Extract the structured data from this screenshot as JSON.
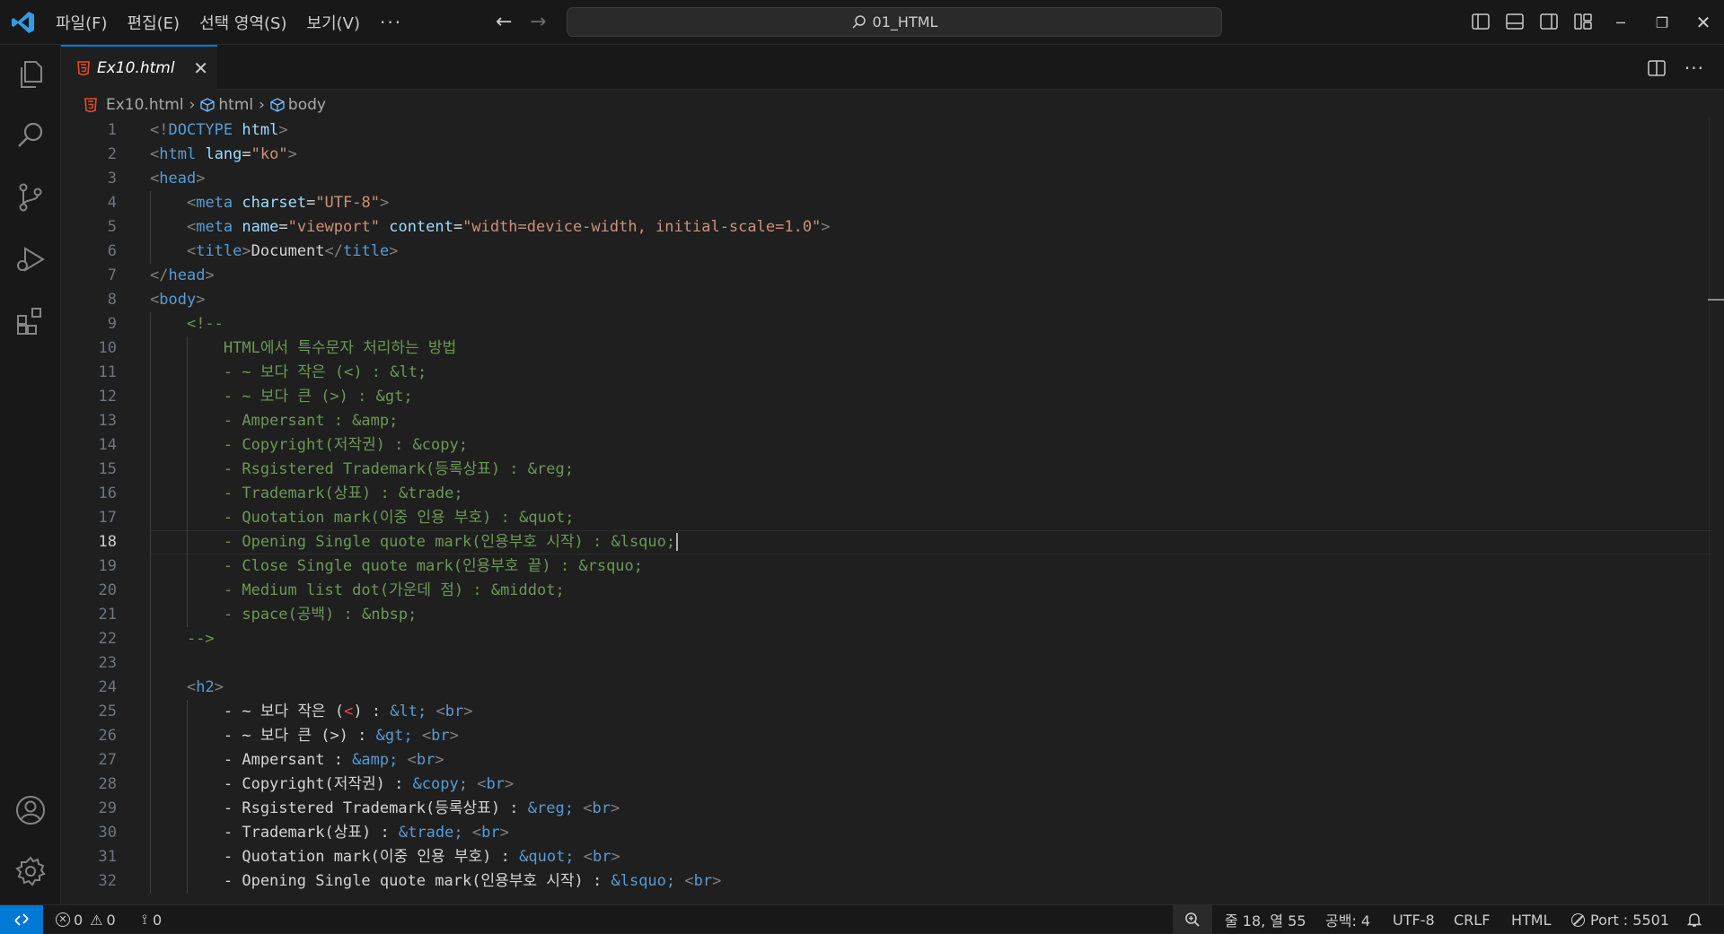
{
  "menu": {
    "file": "파일(F)",
    "edit": "편집(E)",
    "selection": "선택 영역(S)",
    "view": "보기(V)",
    "more": "···"
  },
  "search": {
    "text": "01_HTML"
  },
  "tab": {
    "filename": "Ex10.html",
    "close": "✕"
  },
  "breadcrumb": {
    "file": "Ex10.html",
    "html": "html",
    "body": "body"
  },
  "editor": {
    "lines": [
      {
        "n": "1",
        "segs": [
          [
            "p",
            "<!"
          ],
          [
            "t",
            "DOCTYPE"
          ],
          [
            "w",
            " "
          ],
          [
            "a",
            "html"
          ],
          [
            "p",
            ">"
          ]
        ]
      },
      {
        "n": "2",
        "segs": [
          [
            "p",
            "<"
          ],
          [
            "t",
            "html"
          ],
          [
            "w",
            " "
          ],
          [
            "a",
            "lang"
          ],
          [
            "w",
            "="
          ],
          [
            "s",
            "\"ko\""
          ],
          [
            "p",
            ">"
          ]
        ]
      },
      {
        "n": "3",
        "segs": [
          [
            "p",
            "<"
          ],
          [
            "t",
            "head"
          ],
          [
            "p",
            ">"
          ]
        ]
      },
      {
        "n": "4",
        "segs": [
          [
            "w",
            "    "
          ],
          [
            "p",
            "<"
          ],
          [
            "t",
            "meta"
          ],
          [
            "w",
            " "
          ],
          [
            "a",
            "charset"
          ],
          [
            "w",
            "="
          ],
          [
            "s",
            "\"UTF-8\""
          ],
          [
            "p",
            ">"
          ]
        ]
      },
      {
        "n": "5",
        "segs": [
          [
            "w",
            "    "
          ],
          [
            "p",
            "<"
          ],
          [
            "t",
            "meta"
          ],
          [
            "w",
            " "
          ],
          [
            "a",
            "name"
          ],
          [
            "w",
            "="
          ],
          [
            "s",
            "\"viewport\""
          ],
          [
            "w",
            " "
          ],
          [
            "a",
            "content"
          ],
          [
            "w",
            "="
          ],
          [
            "s",
            "\"width=device-width, initial-scale=1.0\""
          ],
          [
            "p",
            ">"
          ]
        ]
      },
      {
        "n": "6",
        "segs": [
          [
            "w",
            "    "
          ],
          [
            "p",
            "<"
          ],
          [
            "t",
            "title"
          ],
          [
            "p",
            ">"
          ],
          [
            "w",
            "Document"
          ],
          [
            "p",
            "</"
          ],
          [
            "t",
            "title"
          ],
          [
            "p",
            ">"
          ]
        ]
      },
      {
        "n": "7",
        "segs": [
          [
            "p",
            "</"
          ],
          [
            "t",
            "head"
          ],
          [
            "p",
            ">"
          ]
        ]
      },
      {
        "n": "8",
        "segs": [
          [
            "p",
            "<"
          ],
          [
            "t",
            "body"
          ],
          [
            "p",
            ">"
          ]
        ]
      },
      {
        "n": "9",
        "segs": [
          [
            "w",
            "    "
          ],
          [
            "c",
            "<!--"
          ]
        ]
      },
      {
        "n": "10",
        "segs": [
          [
            "c",
            "        HTML에서 특수문자 처리하는 방법"
          ]
        ]
      },
      {
        "n": "11",
        "segs": [
          [
            "c",
            "        - ~ 보다 작은 (<) : &lt;"
          ]
        ]
      },
      {
        "n": "12",
        "segs": [
          [
            "c",
            "        - ~ 보다 큰 (>) : &gt;"
          ]
        ]
      },
      {
        "n": "13",
        "segs": [
          [
            "c",
            "        - Ampersant : &amp;"
          ]
        ]
      },
      {
        "n": "14",
        "segs": [
          [
            "c",
            "        - Copyright(저작권) : &copy;"
          ]
        ]
      },
      {
        "n": "15",
        "segs": [
          [
            "c",
            "        - Rsgistered Trademark(등록상표) : &reg;"
          ]
        ]
      },
      {
        "n": "16",
        "segs": [
          [
            "c",
            "        - Trademark(상표) : &trade;"
          ]
        ]
      },
      {
        "n": "17",
        "segs": [
          [
            "c",
            "        - Quotation mark(이중 인용 부호) : &quot;"
          ]
        ]
      },
      {
        "n": "18",
        "cur": true,
        "segs": [
          [
            "c",
            "        - Opening Single quote mark(인용부호 시작) : &lsquo;"
          ]
        ]
      },
      {
        "n": "19",
        "segs": [
          [
            "c",
            "        - Close Single quote mark(인용부호 끝) : &rsquo;"
          ]
        ]
      },
      {
        "n": "20",
        "segs": [
          [
            "c",
            "        - Medium list dot(가운데 점) : &middot;"
          ]
        ]
      },
      {
        "n": "21",
        "segs": [
          [
            "c",
            "        - space(공백) : &nbsp;"
          ]
        ]
      },
      {
        "n": "22",
        "segs": [
          [
            "c",
            "    -->"
          ]
        ]
      },
      {
        "n": "23",
        "segs": []
      },
      {
        "n": "24",
        "segs": [
          [
            "w",
            "    "
          ],
          [
            "p",
            "<"
          ],
          [
            "t",
            "h2"
          ],
          [
            "p",
            ">"
          ]
        ]
      },
      {
        "n": "25",
        "segs": [
          [
            "w",
            "        - ~ 보다 작은 ("
          ],
          [
            "r",
            "<"
          ],
          [
            "w",
            ") : "
          ],
          [
            "e",
            "&lt;"
          ],
          [
            "w",
            " "
          ],
          [
            "p",
            "<"
          ],
          [
            "t",
            "br"
          ],
          [
            "p",
            ">"
          ]
        ]
      },
      {
        "n": "26",
        "segs": [
          [
            "w",
            "        - ~ 보다 큰 (>) : "
          ],
          [
            "e",
            "&gt;"
          ],
          [
            "w",
            " "
          ],
          [
            "p",
            "<"
          ],
          [
            "t",
            "br"
          ],
          [
            "p",
            ">"
          ]
        ]
      },
      {
        "n": "27",
        "segs": [
          [
            "w",
            "        - Ampersant : "
          ],
          [
            "e",
            "&amp;"
          ],
          [
            "w",
            " "
          ],
          [
            "p",
            "<"
          ],
          [
            "t",
            "br"
          ],
          [
            "p",
            ">"
          ]
        ]
      },
      {
        "n": "28",
        "segs": [
          [
            "w",
            "        - Copyright(저작권) : "
          ],
          [
            "e",
            "&copy;"
          ],
          [
            "w",
            " "
          ],
          [
            "p",
            "<"
          ],
          [
            "t",
            "br"
          ],
          [
            "p",
            ">"
          ]
        ]
      },
      {
        "n": "29",
        "segs": [
          [
            "w",
            "        - Rsgistered Trademark(등록상표) : "
          ],
          [
            "e",
            "&reg;"
          ],
          [
            "w",
            " "
          ],
          [
            "p",
            "<"
          ],
          [
            "t",
            "br"
          ],
          [
            "p",
            ">"
          ]
        ]
      },
      {
        "n": "30",
        "segs": [
          [
            "w",
            "        - Trademark(상표) : "
          ],
          [
            "e",
            "&trade;"
          ],
          [
            "w",
            " "
          ],
          [
            "p",
            "<"
          ],
          [
            "t",
            "br"
          ],
          [
            "p",
            ">"
          ]
        ]
      },
      {
        "n": "31",
        "segs": [
          [
            "w",
            "        - Quotation mark(이중 인용 부호) : "
          ],
          [
            "e",
            "&quot;"
          ],
          [
            "w",
            " "
          ],
          [
            "p",
            "<"
          ],
          [
            "t",
            "br"
          ],
          [
            "p",
            ">"
          ]
        ]
      },
      {
        "n": "32",
        "segs": [
          [
            "w",
            "        - Opening Single quote mark(인용부호 시작) : "
          ],
          [
            "e",
            "&lsquo;"
          ],
          [
            "w",
            " "
          ],
          [
            "p",
            "<"
          ],
          [
            "t",
            "br"
          ],
          [
            "p",
            ">"
          ]
        ]
      }
    ]
  },
  "status": {
    "errors": "0",
    "warnings": "0",
    "ports": "0",
    "position": "줄 18, 열 55",
    "spaces": "공백: 4",
    "encoding": "UTF-8",
    "eol": "CRLF",
    "language": "HTML",
    "port": "Port : 5501"
  },
  "colors": {
    "accent": "#0078d4",
    "keyword": "#569cd6",
    "attribute": "#9cdcfe",
    "string": "#ce9178",
    "comment": "#6a9955"
  }
}
